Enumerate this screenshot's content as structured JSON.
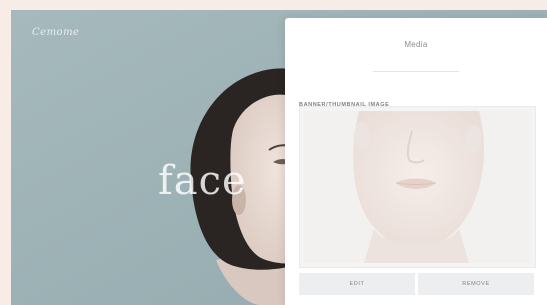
{
  "hero": {
    "brand": "Cemome",
    "title": "face"
  },
  "panel": {
    "tab_label": "Media",
    "section_label": "BANNER/THUMBNAIL IMAGE",
    "edit_label": "EDIT",
    "remove_label": "REMOVE"
  },
  "colors": {
    "page_bg": "#f7ece6",
    "hero_bg": "#9fb4b8",
    "panel_bg": "#ffffff",
    "button_bg": "#eceeef"
  }
}
